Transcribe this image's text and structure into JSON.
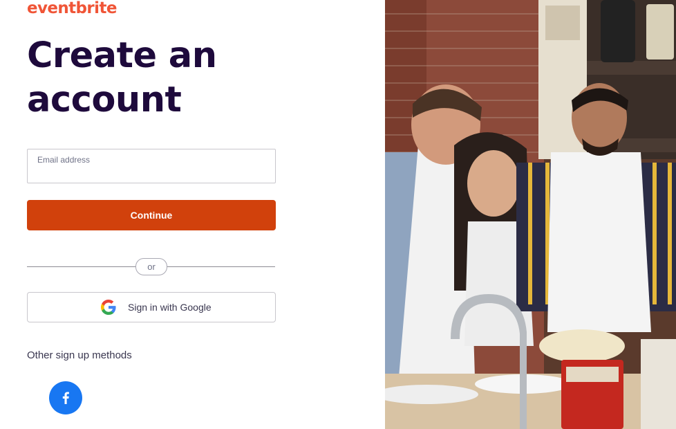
{
  "brand": {
    "logo_text": "eventbrite",
    "accent_color": "#f05537"
  },
  "heading": {
    "title": "Create an account"
  },
  "form": {
    "email_label": "Email address",
    "email_value": "",
    "continue_label": "Continue",
    "continue_color": "#d1410c"
  },
  "divider": {
    "text": "or"
  },
  "google": {
    "label": "Sign in with Google",
    "icon": "google-icon"
  },
  "other": {
    "label": "Other sign up methods",
    "facebook_icon": "facebook-icon",
    "facebook_color": "#1877f2"
  },
  "hero_image": {
    "description_icon": "people-cooking-photo"
  }
}
